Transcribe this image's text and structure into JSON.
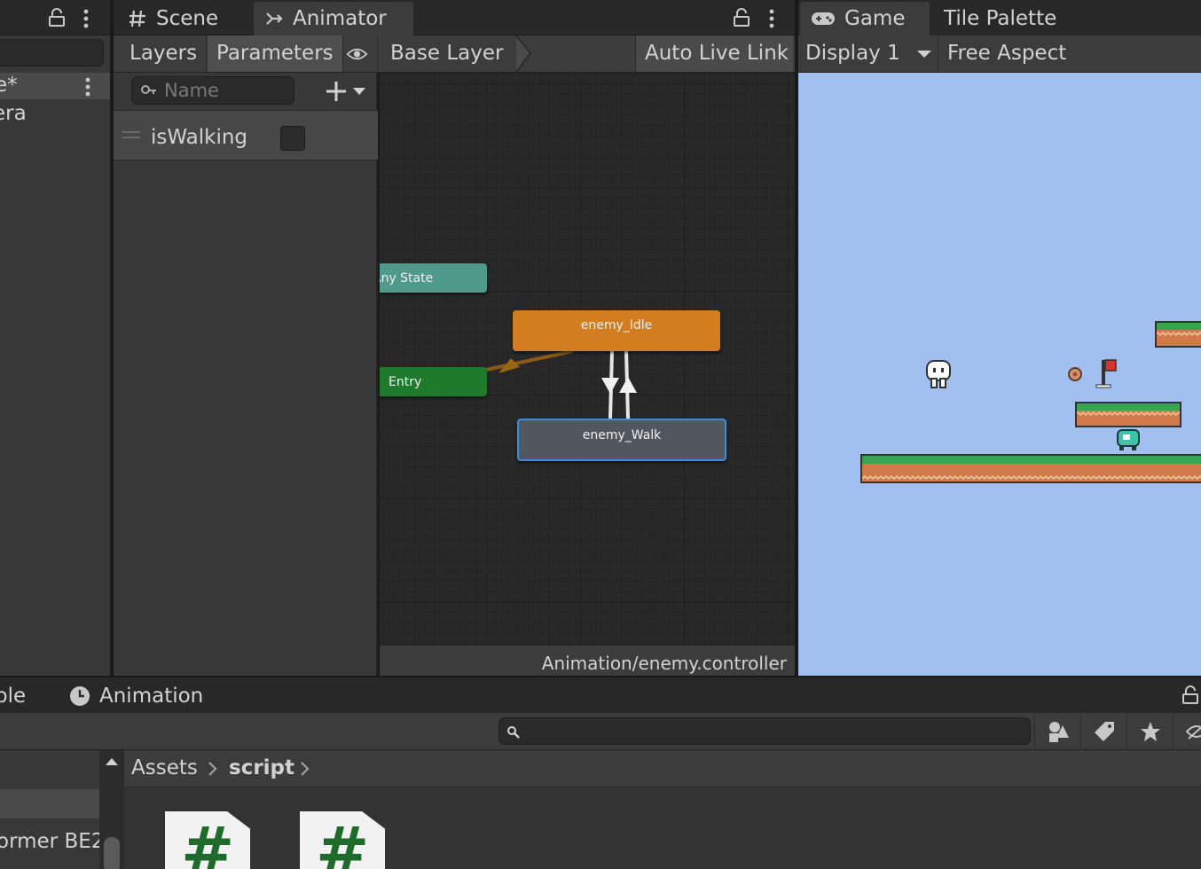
{
  "hierarchy": {
    "selected_item": "e*",
    "item2": "era"
  },
  "animator": {
    "tab_scene": "Scene",
    "tab_animator": "Animator",
    "tab_layers": "Layers",
    "tab_parameters": "Parameters",
    "breadcrumb": "Base Layer",
    "auto_live_link": "Auto Live Link",
    "search_placeholder": "Name",
    "parameters": [
      {
        "name": "isWalking",
        "type": "bool",
        "value": false
      }
    ],
    "nodes": {
      "any_state": "Any State",
      "entry": "Entry",
      "idle": "enemy_Idle",
      "walk": "enemy_Walk"
    },
    "footer_path": "Animation/enemy.controller",
    "colors": {
      "idle": "#d27d1f",
      "walk": "#52575f",
      "any_state": "#4f9a8b",
      "entry": "#1f7a2c",
      "selection": "#3d8be0"
    }
  },
  "game": {
    "tab_game": "Game",
    "tab_tile_palette": "Tile Palette",
    "display": "Display 1",
    "aspect": "Free Aspect",
    "sky_color": "#a1bfef"
  },
  "project": {
    "tab_left": "ble",
    "tab_animation": "Animation",
    "tree_item": "ormer BE2",
    "breadcrumb": [
      "Assets",
      "script"
    ],
    "file_glyph": "#"
  }
}
